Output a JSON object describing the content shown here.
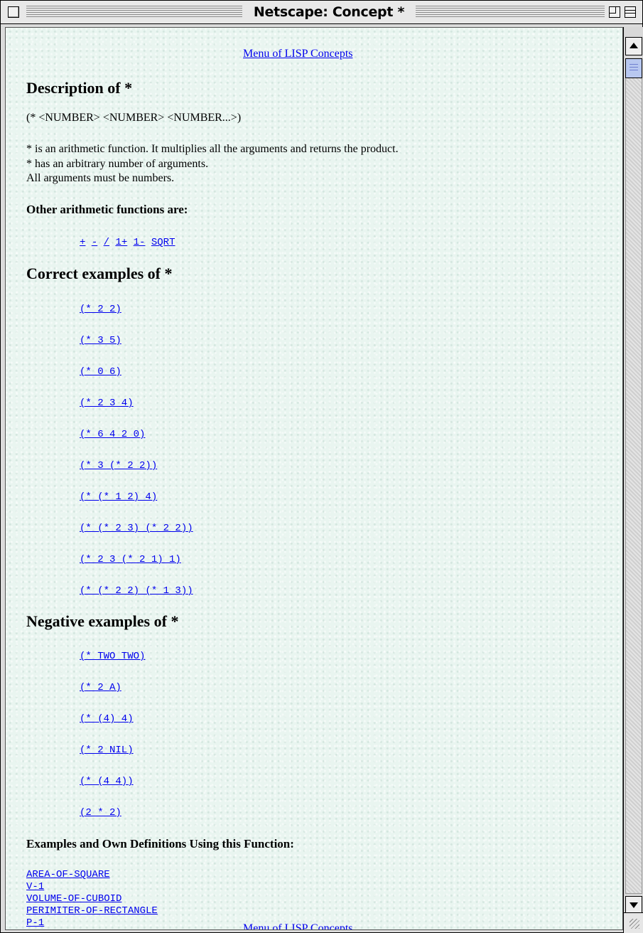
{
  "window": {
    "title": "Netscape: Concept *"
  },
  "page": {
    "top_link": "Menu of LISP Concepts",
    "heading": "Description of *",
    "syntax": "(* <NUMBER> <NUMBER> <NUMBER...>)",
    "description_lines": [
      "* is an arithmetic function. It multiplies all the arguments and returns the product.",
      "* has an arbitrary number of arguments.",
      "All arguments must be numbers."
    ],
    "other_heading": "Other arithmetic functions are:",
    "other_functions": [
      "+",
      "-",
      "/",
      "1+",
      "1-",
      "SQRT"
    ],
    "correct_heading": "Correct examples of *",
    "correct_examples": [
      "(* 2 2)",
      "(* 3 5)",
      "(* 0 6)",
      "(* 2 3 4)",
      "(* 6 4 2 0)",
      "(* 3 (* 2 2))",
      "(* (* 1 2) 4)",
      "(* (* 2 3) (* 2 2))",
      "(* 2 3 (* 2 1) 1)",
      "(* (* 2 2) (* 1 3))"
    ],
    "negative_heading": "Negative examples of *",
    "negative_examples": [
      "(* TWO TWO)",
      "(* 2 A)",
      "(* (4) 4)",
      "(* 2 NIL)",
      "(* (4 4))",
      "(2 * 2)"
    ],
    "usage_heading": "Examples and Own Definitions Using this Function:",
    "usage_links": [
      "AREA-OF-SQUARE",
      "V-1",
      "VOLUME-OF-CUBOID",
      "PERIMITER-OF-RECTANGLE",
      "P-1"
    ],
    "bottom_link": "Menu of LISP Concepts"
  },
  "icons": {
    "close": "close-box-icon",
    "zoom": "zoom-box-icon",
    "collapse": "collapse-box-icon",
    "scroll_up": "scroll-up-arrow-icon",
    "scroll_down": "scroll-down-arrow-icon",
    "grow": "grow-box-icon"
  },
  "colors": {
    "link": "#0000ee",
    "page_background": "#e9f5f0"
  }
}
